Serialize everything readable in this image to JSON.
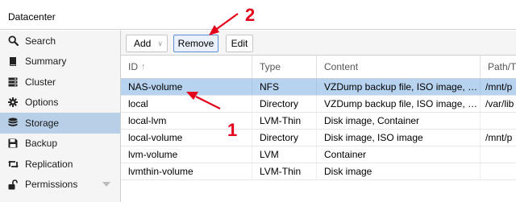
{
  "header": {
    "title": "Datacenter"
  },
  "sidebar": {
    "items": [
      {
        "label": "Search",
        "icon": "search-icon",
        "selected": false
      },
      {
        "label": "Summary",
        "icon": "book-icon",
        "selected": false
      },
      {
        "label": "Cluster",
        "icon": "server-icon",
        "selected": false
      },
      {
        "label": "Options",
        "icon": "gear-icon",
        "selected": false
      },
      {
        "label": "Storage",
        "icon": "database-icon",
        "selected": true
      },
      {
        "label": "Backup",
        "icon": "floppy-icon",
        "selected": false
      },
      {
        "label": "Replication",
        "icon": "retweet-icon",
        "selected": false
      },
      {
        "label": "Permissions",
        "icon": "unlock-icon",
        "selected": false,
        "expandable": true
      }
    ]
  },
  "toolbar": {
    "add_label": "Add",
    "remove_label": "Remove",
    "edit_label": "Edit"
  },
  "grid": {
    "columns": [
      "ID",
      "Type",
      "Content",
      "Path/T"
    ],
    "sort_column": "ID",
    "sort_direction": "ascending",
    "rows": [
      {
        "id": "NAS-volume",
        "type": "NFS",
        "content": "VZDump backup file, ISO image, …",
        "path": "/mnt/p",
        "selected": true
      },
      {
        "id": "local",
        "type": "Directory",
        "content": "VZDump backup file, ISO image, …",
        "path": "/var/lib",
        "selected": false
      },
      {
        "id": "local-lvm",
        "type": "LVM-Thin",
        "content": "Disk image, Container",
        "path": "",
        "selected": false
      },
      {
        "id": "local-volume",
        "type": "Directory",
        "content": "Disk image, ISO image",
        "path": "/mnt/p",
        "selected": false
      },
      {
        "id": "lvm-volume",
        "type": "LVM",
        "content": "Container",
        "path": "",
        "selected": false
      },
      {
        "id": "lvmthin-volume",
        "type": "LVM-Thin",
        "content": "Disk image",
        "path": "",
        "selected": false
      }
    ]
  },
  "annotations": {
    "step1": "1",
    "step2": "2",
    "color": "#e3001b"
  },
  "colors": {
    "selection": "#b8cfe8",
    "row_selection": "#b8d3ef",
    "focus_border": "#5b8fd1"
  }
}
